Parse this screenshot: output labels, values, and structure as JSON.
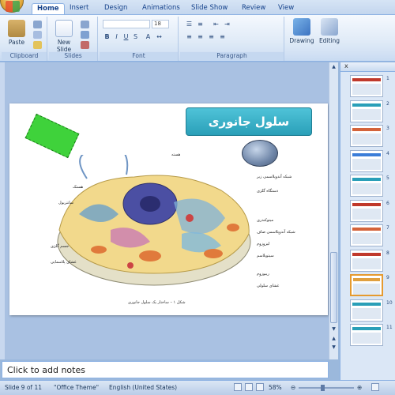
{
  "tabs": [
    "Home",
    "Insert",
    "Design",
    "Animations",
    "Slide Show",
    "Review",
    "View"
  ],
  "ribbon": {
    "groups": {
      "clipboard": "Clipboard",
      "slides": "Slides",
      "font": "Font",
      "paragraph": "Paragraph"
    },
    "paste_label": "Paste",
    "new_slide_label": "New Slide",
    "drawing_label": "Drawing",
    "editing_label": "Editing",
    "font_size": "18"
  },
  "slide": {
    "title": "سلول جانوری",
    "caption": "شکل ۱ – ساختار یک سلول جانوری",
    "labels_right": [
      "شبکه آندوپلاسمی زبر",
      "دستگاه گلژی",
      "میتوکندری",
      "شبکه آندوپلاسمی صاف",
      "لیزوزوم",
      "سیتوپلاسم",
      "ریبوزوم",
      "غشای سلولی"
    ],
    "labels_left": [
      "هسته",
      "هستک",
      "سانتریول",
      "جسم گلژی",
      "غشای پلاسمایی"
    ]
  },
  "notes_placeholder": "Click to add notes",
  "thumbnails": [
    "1",
    "2",
    "3",
    "4",
    "5",
    "6",
    "7",
    "8",
    "9",
    "10",
    "11"
  ],
  "selected_slide": "9",
  "status": {
    "slide_info": "Slide 9 of 11",
    "theme": "\"Office Theme\"",
    "language": "English (United States)",
    "zoom": "58%"
  },
  "colors": {
    "accent": "#2a9fb8",
    "callout": "#3fd23b",
    "selection": "#e59a2f"
  }
}
